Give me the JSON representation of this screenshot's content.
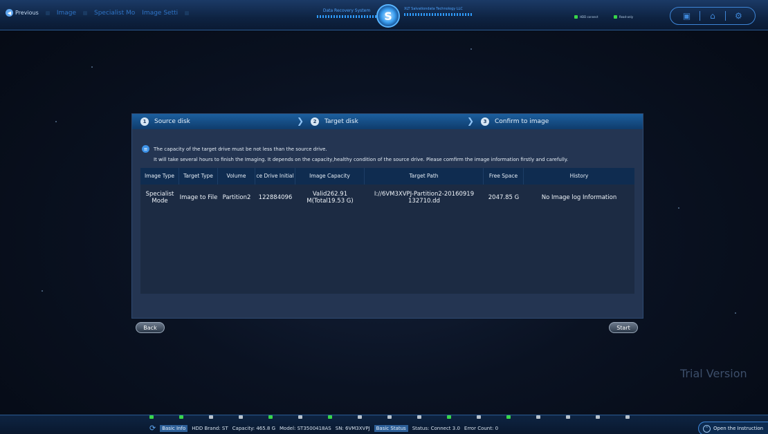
{
  "nav": {
    "previous": "Previous",
    "crumbs": [
      "Image",
      "Specialist Mo",
      "Image Setti"
    ]
  },
  "brand": {
    "left_text": "Data Recovery System",
    "right_text": "XLT Salvationdata Technology LLC",
    "logo_glyph": "S"
  },
  "status": {
    "hdd_connect": "HDD connect",
    "read_only": "Read-only",
    "led_color": "#38d64a"
  },
  "toolbar": {
    "icons": [
      "monitor-icon",
      "home-icon",
      "settings-icon"
    ]
  },
  "steps": [
    {
      "num": "1",
      "label": "Source disk"
    },
    {
      "num": "2",
      "label": "Target disk"
    },
    {
      "num": "3",
      "label": "Confirm to image"
    }
  ],
  "notice": {
    "line1": "The capacity of the target drive must be not less than the source drive.",
    "line2": "It will take several hours to finish the Imaging. It depends on the capacity,healthy condition of the source drive. Please comfirm the image information firstly and carefully."
  },
  "table": {
    "headers": [
      "Image Type",
      "Target Type",
      "Volume",
      "ce Drive Initial",
      "Image Capacity",
      "Target Path",
      "Free Space",
      "History"
    ],
    "rows": [
      [
        "Specialist Mode",
        "Image to File",
        "Partition2",
        "122884096",
        "Valid262.91 M(Total19.53 G)",
        "I://6VM3XVPJ-Partition2-20160919 132710.dd",
        "2047.85 G",
        "No Image log Information"
      ]
    ]
  },
  "buttons": {
    "back": "Back",
    "start": "Start"
  },
  "watermark": "Trial Version",
  "bottom": {
    "basic_info": "Basic Info",
    "hdd_brand": "HDD Brand: ST",
    "capacity": "Capacity: 465.8 G",
    "model": "Model: ST3500418AS",
    "sn": "SN:   6VM3XVPJ",
    "basic_status": "Basic Status",
    "status": "Status: Connect 3.0",
    "error_count": "Error Count: 0",
    "leds": [
      "#38d64a",
      "#38d64a",
      "#b8c2cc",
      "#b8c2cc",
      "#38d64a",
      "#b8c2cc",
      "#38d64a",
      "#b8c2cc",
      "#b8c2cc",
      "#b8c2cc",
      "#38d64a",
      "#b8c2cc",
      "#38d64a",
      "#b8c2cc",
      "#b8c2cc",
      "#b8c2cc",
      "#b8c2cc"
    ]
  },
  "instructions": "Open the Instruction"
}
